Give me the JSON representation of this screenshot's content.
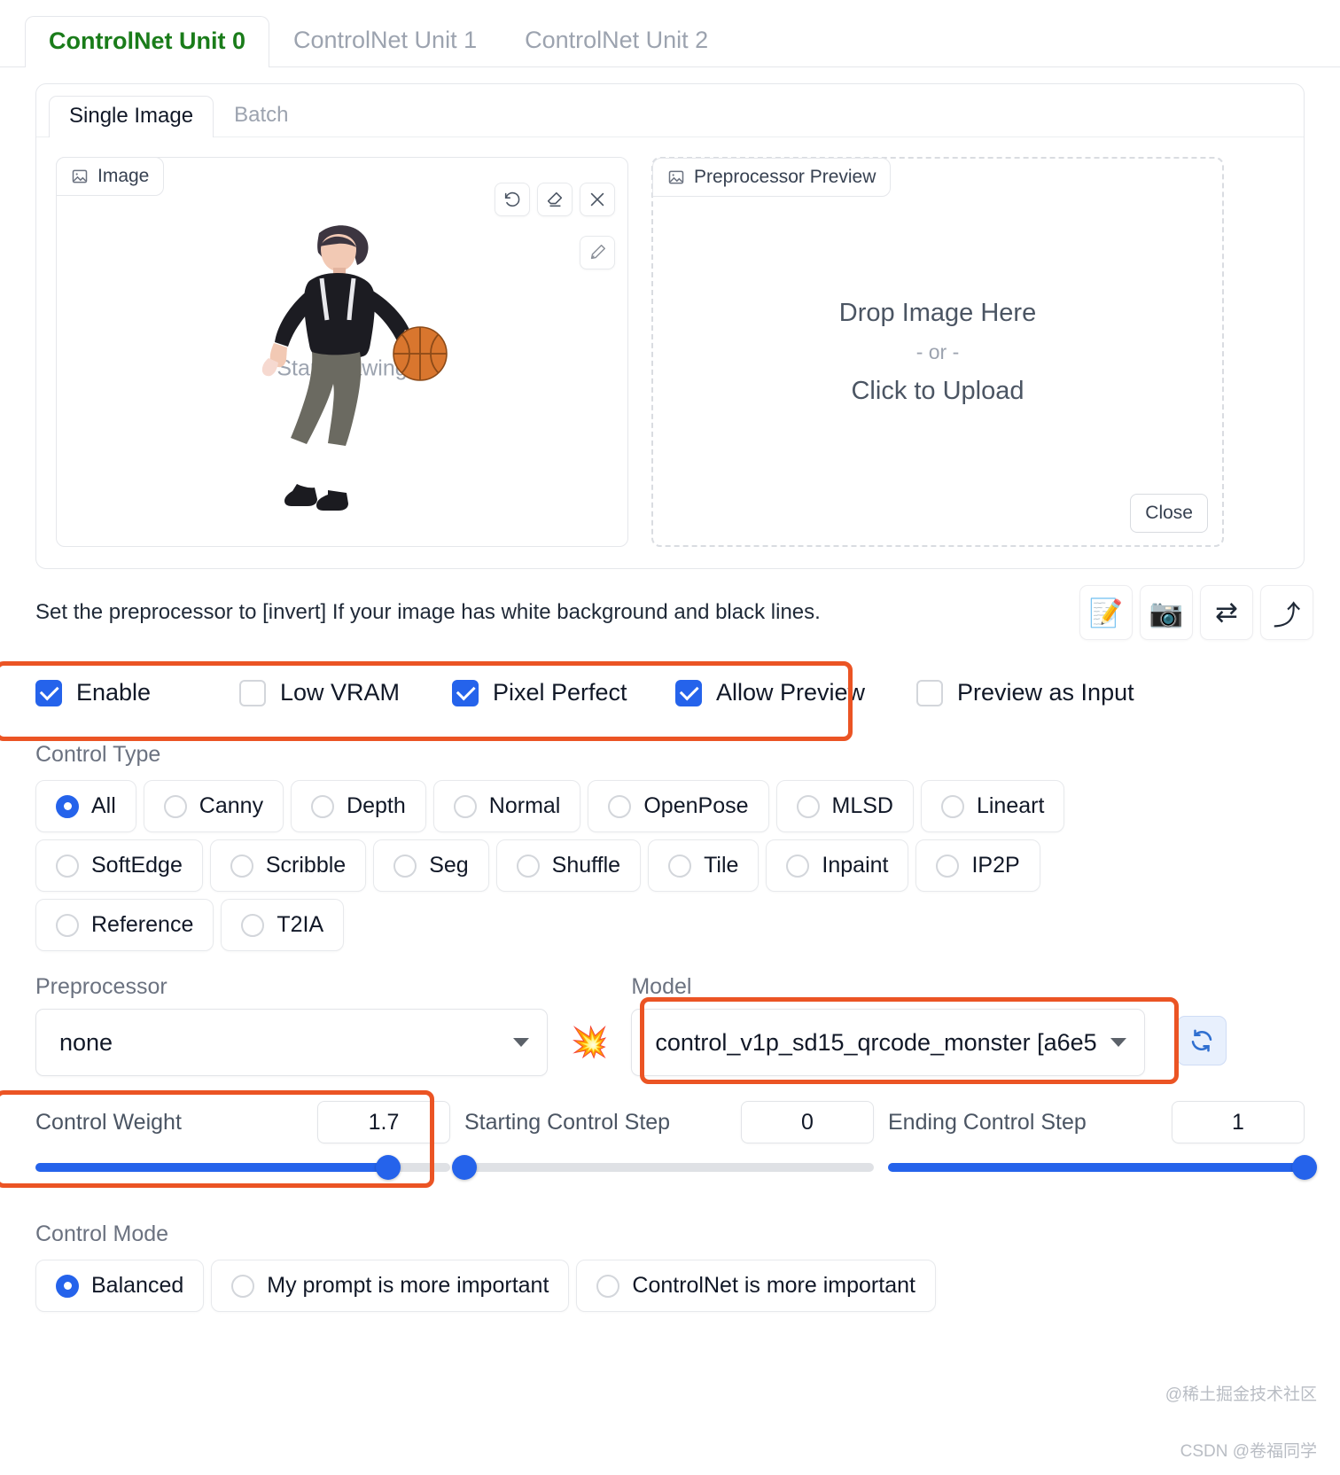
{
  "unit_tabs": [
    {
      "label": "ControlNet Unit 0",
      "active": true
    },
    {
      "label": "ControlNet Unit 1",
      "active": false
    },
    {
      "label": "ControlNet Unit 2",
      "active": false
    }
  ],
  "sub_tabs": [
    {
      "label": "Single Image",
      "active": true
    },
    {
      "label": "Batch",
      "active": false
    }
  ],
  "image_panel": {
    "chip_label": "Image",
    "chip_icon": "image-icon",
    "placeholder": "Start drawing",
    "tools": [
      {
        "name": "undo-icon",
        "title": "Undo"
      },
      {
        "name": "eraser-icon",
        "title": "Erase"
      },
      {
        "name": "close-icon",
        "title": "Remove"
      }
    ],
    "pen_tool": {
      "name": "pen-icon",
      "title": "Draw"
    }
  },
  "preview_panel": {
    "chip_label": "Preprocessor Preview",
    "chip_icon": "image-icon",
    "drop_text": "Drop Image Here",
    "or_text": "- or -",
    "upload_text": "Click to Upload",
    "close_label": "Close"
  },
  "hint": {
    "text": "Set the preprocessor to [invert] If your image has white background and black lines.",
    "buttons": [
      {
        "name": "open-new-canvas-icon",
        "glyph": "📝"
      },
      {
        "name": "webcam-icon",
        "glyph": "📷"
      },
      {
        "name": "mirror-webcam-icon",
        "glyph": "⇄"
      },
      {
        "name": "send-dimensions-icon",
        "glyph": "⤴"
      }
    ]
  },
  "checkboxes": [
    {
      "label": "Enable",
      "checked": true
    },
    {
      "label": "Low VRAM",
      "checked": false
    },
    {
      "label": "Pixel Perfect",
      "checked": true
    },
    {
      "label": "Allow Preview",
      "checked": true
    },
    {
      "label": "Preview as Input",
      "checked": false
    }
  ],
  "control_type": {
    "label": "Control Type",
    "options": [
      {
        "label": "All",
        "selected": true
      },
      {
        "label": "Canny",
        "selected": false
      },
      {
        "label": "Depth",
        "selected": false
      },
      {
        "label": "Normal",
        "selected": false
      },
      {
        "label": "OpenPose",
        "selected": false
      },
      {
        "label": "MLSD",
        "selected": false
      },
      {
        "label": "Lineart",
        "selected": false
      },
      {
        "label": "SoftEdge",
        "selected": false
      },
      {
        "label": "Scribble",
        "selected": false
      },
      {
        "label": "Seg",
        "selected": false
      },
      {
        "label": "Shuffle",
        "selected": false
      },
      {
        "label": "Tile",
        "selected": false
      },
      {
        "label": "Inpaint",
        "selected": false
      },
      {
        "label": "IP2P",
        "selected": false
      },
      {
        "label": "Reference",
        "selected": false
      },
      {
        "label": "T2IA",
        "selected": false
      }
    ]
  },
  "preprocessor": {
    "label": "Preprocessor",
    "value": "none"
  },
  "model": {
    "label": "Model",
    "value": "control_v1p_sd15_qrcode_monster [a6e5",
    "run_icon": "explosion-icon",
    "refresh_icon": "refresh-icon"
  },
  "sliders": {
    "control_weight": {
      "label": "Control Weight",
      "value": "1.7",
      "percent": 85
    },
    "starting_step": {
      "label": "Starting Control Step",
      "value": "0",
      "percent": 0
    },
    "ending_step": {
      "label": "Ending Control Step",
      "value": "1",
      "percent": 100
    }
  },
  "control_mode": {
    "label": "Control Mode",
    "options": [
      {
        "label": "Balanced",
        "selected": true
      },
      {
        "label": "My prompt is more important",
        "selected": false
      },
      {
        "label": "ControlNet is more important",
        "selected": false
      }
    ]
  },
  "watermark": {
    "line1": "@稀土掘金技术社区",
    "line2": "CSDN @卷福同学"
  },
  "colors": {
    "highlight": "#eb5424",
    "accent": "#2563eb",
    "active_tab": "#1a7c1a"
  }
}
